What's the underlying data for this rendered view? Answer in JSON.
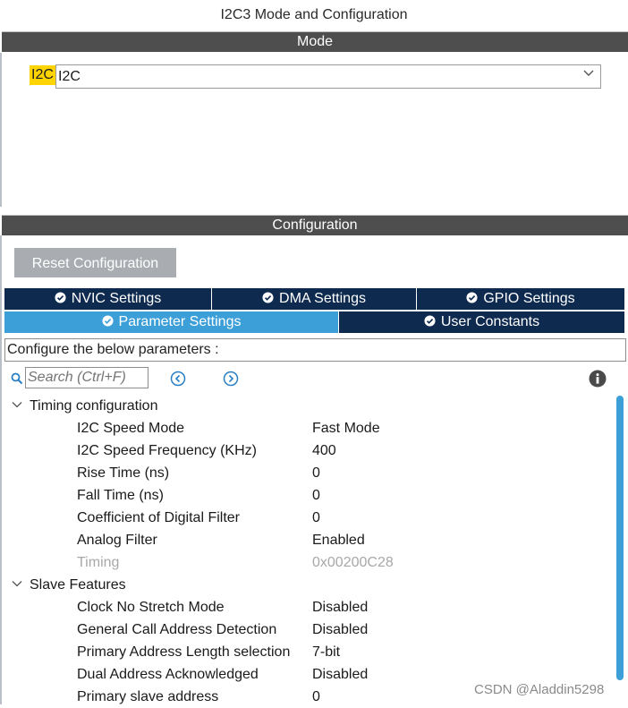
{
  "window_title": "I2C3 Mode and Configuration",
  "mode": {
    "section_label": "Mode",
    "field_label": "I2C",
    "selected_value": "I2C"
  },
  "configuration": {
    "section_label": "Configuration",
    "reset_button": "Reset Configuration",
    "tabs_row1": [
      {
        "label": "NVIC Settings"
      },
      {
        "label": "DMA Settings"
      },
      {
        "label": "GPIO Settings"
      }
    ],
    "tabs_row2": [
      {
        "label": "Parameter Settings",
        "active": true
      },
      {
        "label": "User Constants",
        "active": false
      }
    ],
    "hint": "Configure the below parameters :",
    "search_placeholder": "Search (Ctrl+F)"
  },
  "groups": [
    {
      "name": "Timing configuration",
      "params": [
        {
          "name": "I2C Speed Mode",
          "value": "Fast Mode"
        },
        {
          "name": "I2C Speed Frequency (KHz)",
          "value": "400"
        },
        {
          "name": "Rise Time (ns)",
          "value": "0"
        },
        {
          "name": "Fall Time (ns)",
          "value": "0"
        },
        {
          "name": "Coefficient of Digital Filter",
          "value": "0"
        },
        {
          "name": "Analog Filter",
          "value": "Enabled"
        },
        {
          "name": "Timing",
          "value": "0x00200C28",
          "disabled": true
        }
      ]
    },
    {
      "name": "Slave Features",
      "params": [
        {
          "name": "Clock No Stretch Mode",
          "value": "Disabled"
        },
        {
          "name": "General Call Address Detection",
          "value": "Disabled"
        },
        {
          "name": "Primary Address Length selection",
          "value": "7-bit"
        },
        {
          "name": "Dual Address Acknowledged",
          "value": "Disabled"
        },
        {
          "name": "Primary slave address",
          "value": "0"
        }
      ]
    }
  ],
  "watermark": "CSDN @Aladdin5298",
  "colors": {
    "section_bar": "#4e4e4e",
    "tab_dark": "#0e2a4f",
    "tab_active": "#3d9fd8",
    "highlight": "#ffd400",
    "reset_button": "#a9adb2"
  },
  "icons": [
    "chevron-down-icon",
    "check-circle-icon",
    "search-icon",
    "arrow-left-circle-icon",
    "arrow-right-circle-icon",
    "info-icon",
    "expand-chevron-icon"
  ]
}
